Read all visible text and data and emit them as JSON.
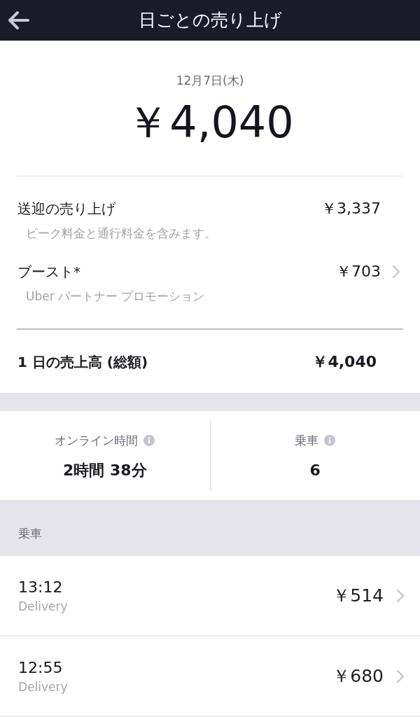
{
  "header": {
    "title": "日ごとの売り上げ"
  },
  "summary": {
    "date": "12月7日(木)",
    "amount": "￥4,040"
  },
  "breakdown": [
    {
      "label": "送迎の売り上げ",
      "note": "ピーク料金と通行料金を含みます。",
      "amount": "￥3,337",
      "has_detail": false
    },
    {
      "label": "ブースト*",
      "note": "Uber パートナー プロモーション",
      "amount": "￥703",
      "has_detail": true
    }
  ],
  "total": {
    "label": "1 日の売上高 (総額)",
    "amount": "￥4,040"
  },
  "stats": [
    {
      "label": "オンライン時間",
      "value": "2時間 38分"
    },
    {
      "label": "乗車",
      "value": "6"
    }
  ],
  "trips_section": {
    "title": "乗車"
  },
  "trips": [
    {
      "time": "13:12",
      "type": "Delivery",
      "amount": "￥514"
    },
    {
      "time": "12:55",
      "type": "Delivery",
      "amount": "￥680"
    }
  ]
}
